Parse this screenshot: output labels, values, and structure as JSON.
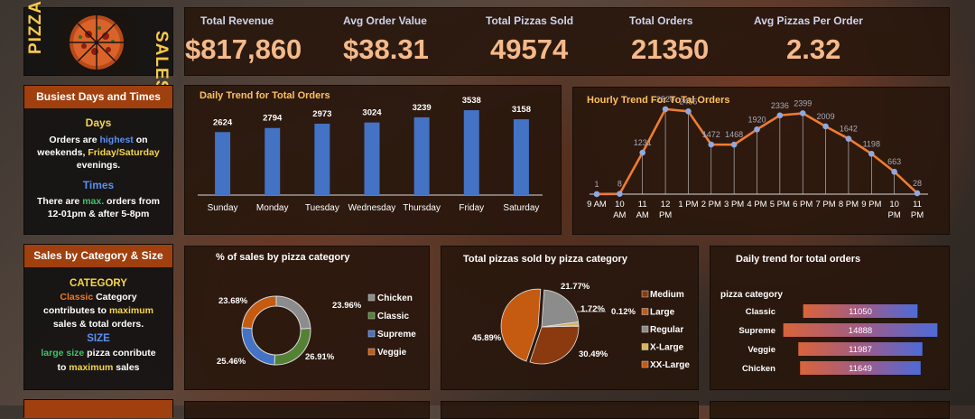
{
  "logo": {
    "left_text": "PIZZA",
    "right_text": "SALES"
  },
  "kpis": [
    {
      "label": "Total Revenue",
      "value": "$817,860"
    },
    {
      "label": "Avg Order Value",
      "value": "$38.31"
    },
    {
      "label": "Total Pizzas Sold",
      "value": "49574"
    },
    {
      "label": "Total Orders",
      "value": "21350"
    },
    {
      "label": "Avg Pizzas Per Order",
      "value": "2.32"
    }
  ],
  "busiest": {
    "title": "Busiest Days and Times",
    "days_heading": "Days",
    "days_l1_a": "Orders are ",
    "days_l1_b": "highest",
    "days_l1_c": " on",
    "days_l2_a": "weekends, ",
    "days_l2_b": "Friday/Saturday",
    "days_l3": "evenings.",
    "times_heading": "Times",
    "times_l1_a": "There are ",
    "times_l1_b": "max.",
    "times_l1_c": " orders from",
    "times_l2": "12-01pm & after 5-8pm"
  },
  "category_size": {
    "title": "Sales by Category & Size",
    "cat_heading": "CATEGORY",
    "cat_l1_a": "Classic",
    "cat_l1_b": " Category",
    "cat_l2_a": "contributes to ",
    "cat_l2_b": "maximum",
    "cat_l3": "sales & total orders.",
    "size_heading": "SIZE",
    "size_l1_a": "large size",
    "size_l1_b": " pizza conribute",
    "size_l2_a": "to ",
    "size_l2_b": "maximum",
    "size_l2_c": " sales"
  },
  "colors": {
    "bar_blue": "#4472c4",
    "line_orange": "#ed7d31",
    "marker_blue": "#8fa9e0",
    "pie_orange": "#c55a11",
    "pie_gray": "#8c8c8c",
    "pie_green": "#548235",
    "pie_blue": "#4472c4",
    "pie_brown": "#8b3a0f",
    "pie_yellow": "#d6b656"
  },
  "chart_data": [
    {
      "id": "daily",
      "type": "bar",
      "title": "Daily Trend for Total Orders",
      "categories": [
        "Sunday",
        "Monday",
        "Tuesday",
        "Wednesday",
        "Thursday",
        "Friday",
        "Saturday"
      ],
      "values": [
        2624,
        2794,
        2973,
        3024,
        3239,
        3538,
        3158
      ],
      "ylim": [
        0,
        3800
      ],
      "grid": false
    },
    {
      "id": "hourly",
      "type": "line",
      "title": "Hourly Trend For ToTal Orders",
      "categories": [
        [
          "9 AM"
        ],
        [
          "10",
          "AM"
        ],
        [
          "11",
          "AM"
        ],
        [
          "12",
          "PM"
        ],
        [
          "1 PM"
        ],
        [
          "2 PM"
        ],
        [
          "3 PM"
        ],
        [
          "4 PM"
        ],
        [
          "5 PM"
        ],
        [
          "6 PM"
        ],
        [
          "7 PM"
        ],
        [
          "8 PM"
        ],
        [
          "9 PM"
        ],
        [
          "10",
          "PM"
        ],
        [
          "11",
          "PM"
        ]
      ],
      "values": [
        1,
        8,
        1231,
        2520,
        2455,
        1472,
        1468,
        1920,
        2336,
        2399,
        2009,
        1642,
        1198,
        663,
        28
      ],
      "ylim": [
        0,
        3000
      ],
      "grid": false
    },
    {
      "id": "pct_cat",
      "type": "pie",
      "title": "% of sales by pizza category",
      "categories": [
        "Chicken",
        "Classic",
        "Supreme",
        "Veggie"
      ],
      "values": [
        23.96,
        26.91,
        25.46,
        23.68
      ],
      "value_labels": [
        "23.96%",
        "26.91%",
        "25.46%",
        "23.68%"
      ],
      "legend": "right"
    },
    {
      "id": "size_pie",
      "type": "pie",
      "title": "Total pizzas sold by pizza category",
      "categories": [
        "Medium",
        "Large",
        "Regular",
        "X-Large",
        "XX-Large"
      ],
      "values": [
        30.49,
        45.89,
        21.77,
        1.72,
        0.12
      ],
      "value_labels": [
        "30.49%",
        "45.89%",
        "21.77%",
        "1.72%",
        "0.12%"
      ],
      "legend": "right"
    },
    {
      "id": "cat_orders",
      "type": "bar",
      "title": "Daily trend for total orders",
      "legend_title": "pizza category",
      "categories": [
        "Classic",
        "Supreme",
        "Veggie",
        "Chicken"
      ],
      "values": [
        11050,
        14888,
        11987,
        11649
      ],
      "xlim": [
        0,
        15000
      ],
      "orientation": "horizontal"
    }
  ]
}
